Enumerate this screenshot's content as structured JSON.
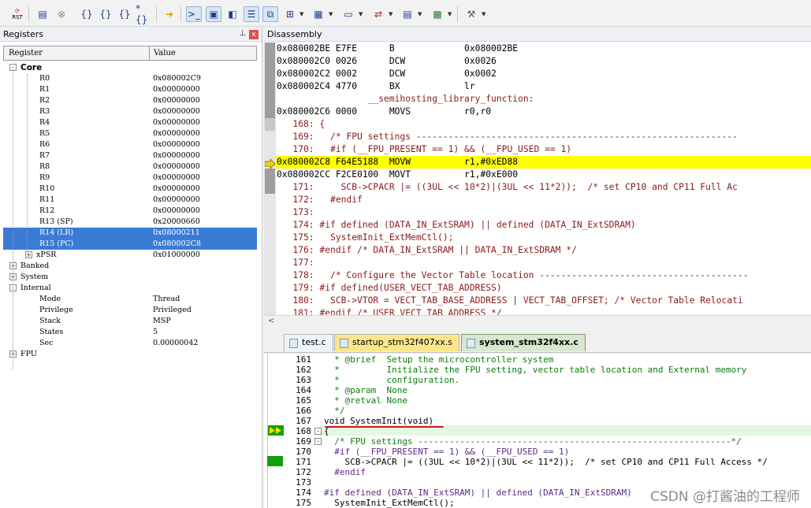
{
  "toolbar": {
    "rst_label": "RST",
    "icons": [
      "reset-icon",
      "step-icon",
      "stop-icon",
      "step-into-icon",
      "step-over-icon",
      "step-out-icon",
      "run-to-cursor-icon",
      "show-next-icon",
      "command-window-icon",
      "disassembly-window-icon",
      "symbols-window-icon",
      "registers-window-icon",
      "call-stack-icon",
      "watch-window-icon",
      "memory-window-icon",
      "serial-window-icon",
      "analysis-window-icon",
      "trace-window-icon",
      "system-viewer-icon",
      "toolbox-icon"
    ]
  },
  "registers": {
    "title": "Registers",
    "pin": "⊥",
    "close": "x",
    "col_register": "Register",
    "col_value": "Value",
    "core_label": "Core",
    "core": [
      {
        "name": "R0",
        "value": "0x080002C9"
      },
      {
        "name": "R1",
        "value": "0x00000000"
      },
      {
        "name": "R2",
        "value": "0x00000000"
      },
      {
        "name": "R3",
        "value": "0x00000000"
      },
      {
        "name": "R4",
        "value": "0x00000000"
      },
      {
        "name": "R5",
        "value": "0x00000000"
      },
      {
        "name": "R6",
        "value": "0x00000000"
      },
      {
        "name": "R7",
        "value": "0x00000000"
      },
      {
        "name": "R8",
        "value": "0x00000000"
      },
      {
        "name": "R9",
        "value": "0x00000000"
      },
      {
        "name": "R10",
        "value": "0x00000000"
      },
      {
        "name": "R11",
        "value": "0x00000000"
      },
      {
        "name": "R12",
        "value": "0x00000000"
      },
      {
        "name": "R13 (SP)",
        "value": "0x20000660"
      },
      {
        "name": "R14 (LR)",
        "value": "0x08000211"
      },
      {
        "name": "R15 (PC)",
        "value": "0x080002C8"
      },
      {
        "name": "xPSR",
        "value": "0x01000000"
      }
    ],
    "banked_label": "Banked",
    "system_label": "System",
    "internal_label": "Internal",
    "internal": [
      {
        "name": "Mode",
        "value": "Thread"
      },
      {
        "name": "Privilege",
        "value": "Privileged"
      },
      {
        "name": "Stack",
        "value": "MSP"
      },
      {
        "name": "States",
        "value": "5"
      },
      {
        "name": "Sec",
        "value": "0.00000042"
      }
    ],
    "fpu_label": "FPU"
  },
  "disassembly": {
    "title": "Disassembly",
    "lines": [
      "0x080002BE E7FE      B             0x080002BE",
      "0x080002C0 0026      DCW           0x0026",
      "0x080002C2 0002      DCW           0x0002",
      "0x080002C4 4770      BX            lr",
      "                 __semihosting_library_function:",
      "0x080002C6 0000      MOVS          r0,r0",
      "   168: {",
      "   169:   /* FPU settings ------------------------------------------------------------",
      "   170:   #if (__FPU_PRESENT == 1) && (__FPU_USED == 1)",
      "0x080002C8 F64E5188  MOVW          r1,#0xED88",
      "0x080002CC F2CE0100  MOVT          r1,#0xE000",
      "   171:     SCB->CPACR |= ((3UL << 10*2)|(3UL << 11*2));  /* set CP10 and CP11 Full Ac",
      "   172:   #endif",
      "   173: ",
      "   174: #if defined (DATA_IN_ExtSRAM) || defined (DATA_IN_ExtSDRAM)",
      "   175:   SystemInit_ExtMemCtl();",
      "   176: #endif /* DATA_IN_ExtSRAM || DATA_IN_ExtSDRAM */",
      "   177: ",
      "   178:   /* Configure the Vector Table location ---------------------------------------",
      "   179: #if defined(USER_VECT_TAB_ADDRESS)",
      "   180:   SCB->VTOR = VECT_TAB_BASE_ADDRESS | VECT_TAB_OFFSET; /* Vector Table Relocati",
      "   181: #endif /* USER_VECT_TAB_ADDRESS */"
    ],
    "scroll_arrow": "<"
  },
  "tabs": [
    {
      "label": "test.c"
    },
    {
      "label": "startup_stm32f407xx.s"
    },
    {
      "label": "system_stm32f4xx.c"
    }
  ],
  "editor": {
    "lines": [
      {
        "no": "161",
        "code": "  * @brief  Setup the microcontroller system"
      },
      {
        "no": "162",
        "code": "  *         Initialize the FPU setting, vector table location and External memory"
      },
      {
        "no": "163",
        "code": "  *         configuration."
      },
      {
        "no": "164",
        "code": "  * @param  None"
      },
      {
        "no": "165",
        "code": "  * @retval None"
      },
      {
        "no": "166",
        "code": "  */"
      },
      {
        "no": "167",
        "code": "void SystemInit(void)"
      },
      {
        "no": "168",
        "code": "{"
      },
      {
        "no": "169",
        "code": "  /* FPU settings ------------------------------------------------------------*/"
      },
      {
        "no": "170",
        "code": "  #if (__FPU_PRESENT == 1) && (__FPU_USED == 1)"
      },
      {
        "no": "171",
        "code": "    SCB->CPACR |= ((3UL << 10*2)|(3UL << 11*2));  /* set CP10 and CP11 Full Access */"
      },
      {
        "no": "172",
        "code": "  #endif"
      },
      {
        "no": "173",
        "code": ""
      },
      {
        "no": "174",
        "code": "#if defined (DATA_IN_ExtSRAM) || defined (DATA_IN_ExtSDRAM)"
      },
      {
        "no": "175",
        "code": "  SystemInit_ExtMemCtl();"
      }
    ]
  },
  "watermark": "CSDN @打酱油的工程师",
  "colors": {
    "selection": "#3a7bd5",
    "current_line": "#ffff00",
    "comment": "#0a7d0a",
    "keyword": "#0a0aa8",
    "source_text": "#8b1a1a"
  }
}
